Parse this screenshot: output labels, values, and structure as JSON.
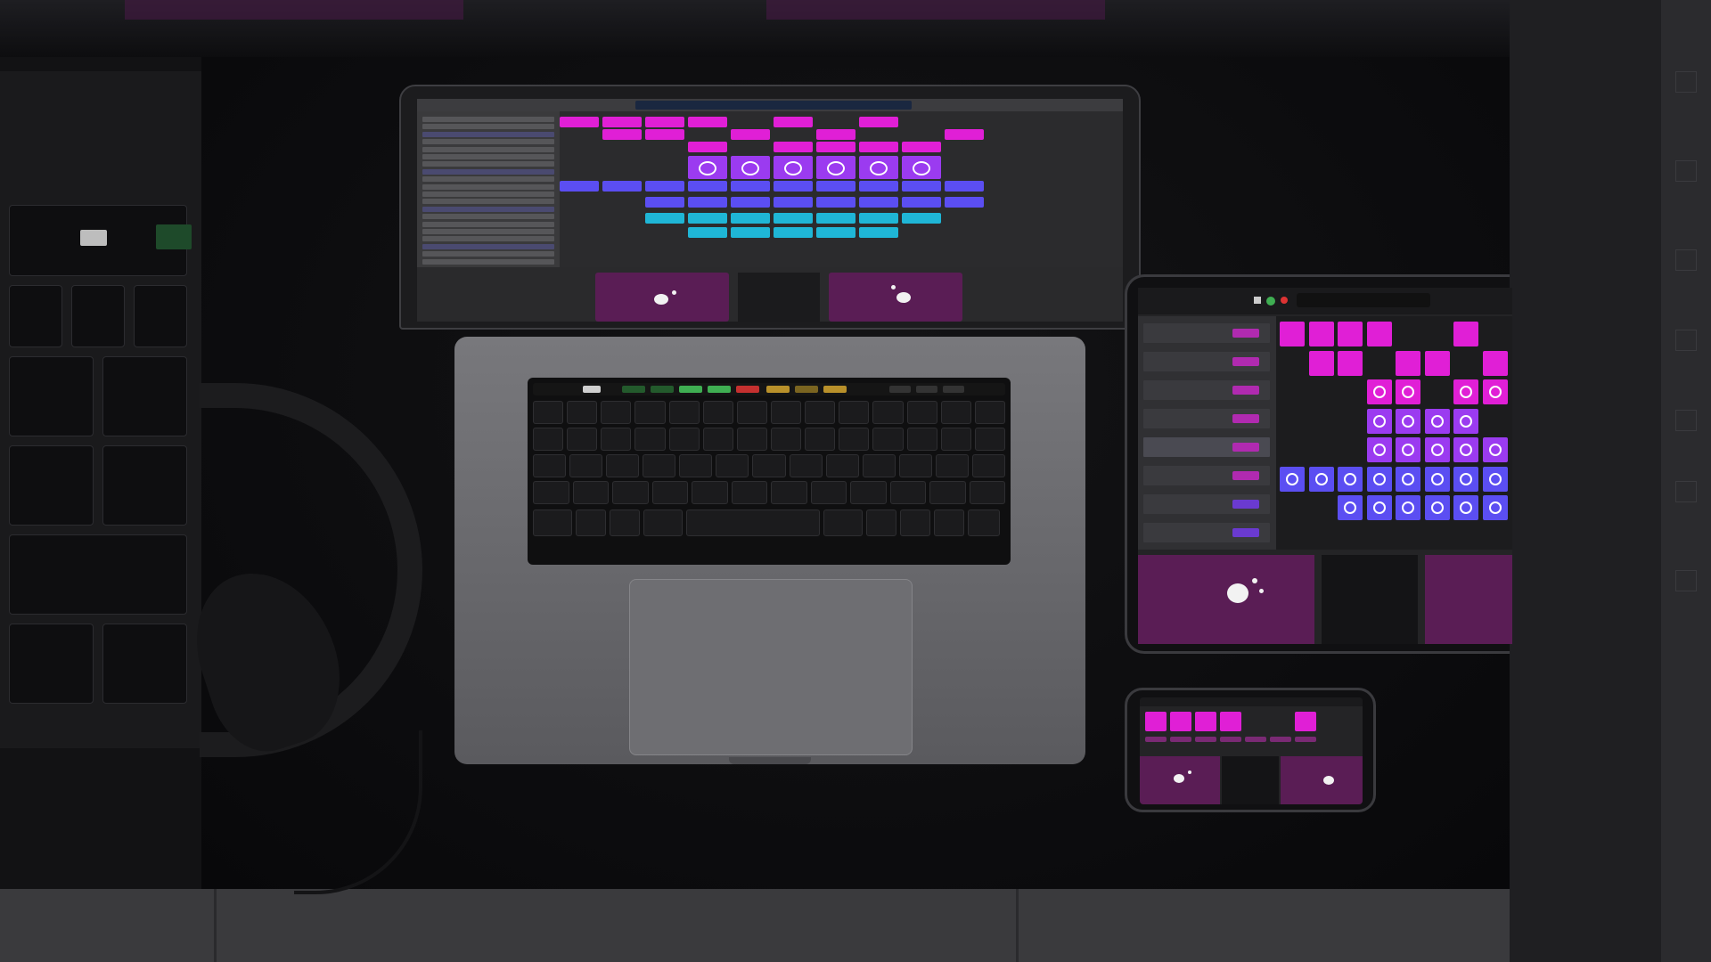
{
  "scene": {
    "description_label": "",
    "devices": [
      "laptop",
      "tablet",
      "phone",
      "headphones"
    ],
    "colors": {
      "pink_cell": "#e01fd6",
      "purple_cell": "#9b3bf0",
      "blue_cell": "#5b4ef2",
      "cyan_cell": "#1fb6d6",
      "pad_magenta": "#5a1d55",
      "desk": "#0a0a0c",
      "aluminum": "#6a6a6e"
    }
  }
}
